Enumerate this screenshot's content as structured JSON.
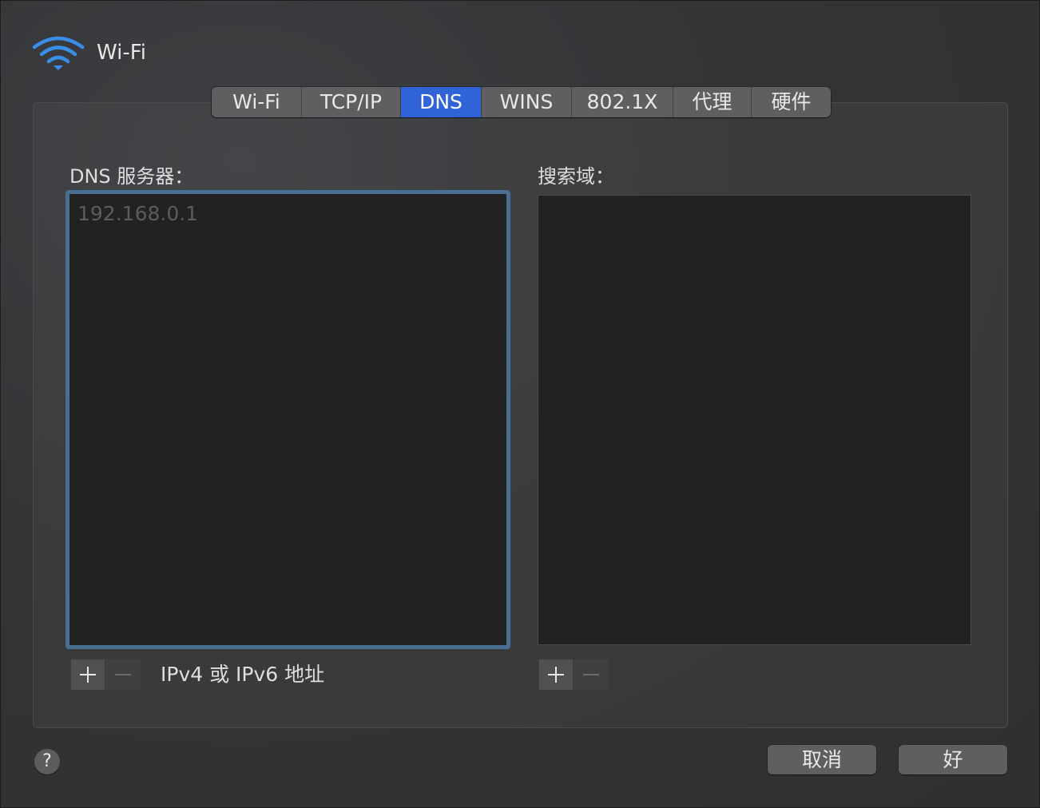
{
  "header": {
    "title": "Wi-Fi",
    "icon": "wifi-icon",
    "accent_color": "#3b8ee8"
  },
  "tabs": [
    {
      "label": "Wi-Fi",
      "active": false
    },
    {
      "label": "TCP/IP",
      "active": false
    },
    {
      "label": "DNS",
      "active": true
    },
    {
      "label": "WINS",
      "active": false
    },
    {
      "label": "802.1X",
      "active": false
    },
    {
      "label": "代理",
      "active": false
    },
    {
      "label": "硬件",
      "active": false
    }
  ],
  "dns_servers": {
    "label": "DNS 服务器：",
    "placeholder": "192.168.0.1",
    "hint": "IPv4 或 IPv6 地址"
  },
  "search_domains": {
    "label": "搜索域："
  },
  "footer": {
    "help_label": "?",
    "cancel_label": "取消",
    "ok_label": "好"
  },
  "colors": {
    "active_tab": "#2f63d6",
    "focus_ring": "#4a6d92"
  }
}
